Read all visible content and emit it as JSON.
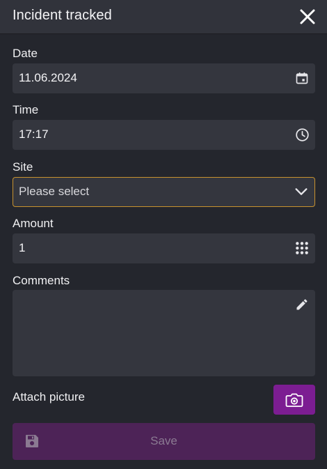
{
  "header": {
    "title": "Incident tracked"
  },
  "form": {
    "date": {
      "label": "Date",
      "value": "11.06.2024"
    },
    "time": {
      "label": "Time",
      "value": "17:17"
    },
    "site": {
      "label": "Site",
      "value": "Please select"
    },
    "amount": {
      "label": "Amount",
      "value": "1"
    },
    "comments": {
      "label": "Comments",
      "value": ""
    },
    "attach": {
      "label": "Attach picture"
    },
    "save_label": "Save"
  },
  "colors": {
    "background": "#24262d",
    "header": "#31333b",
    "field": "#34363e",
    "select_border": "#c8922e",
    "camera_button": "#7c1d92",
    "save_button": "#4d2357"
  },
  "icons": {
    "close": "close-icon",
    "date": "calendar-icon",
    "time": "clock-icon",
    "site": "chevron-down-icon",
    "amount": "keypad-icon",
    "comments": "pencil-icon",
    "attach": "camera-icon",
    "save": "floppy-disk-icon"
  }
}
